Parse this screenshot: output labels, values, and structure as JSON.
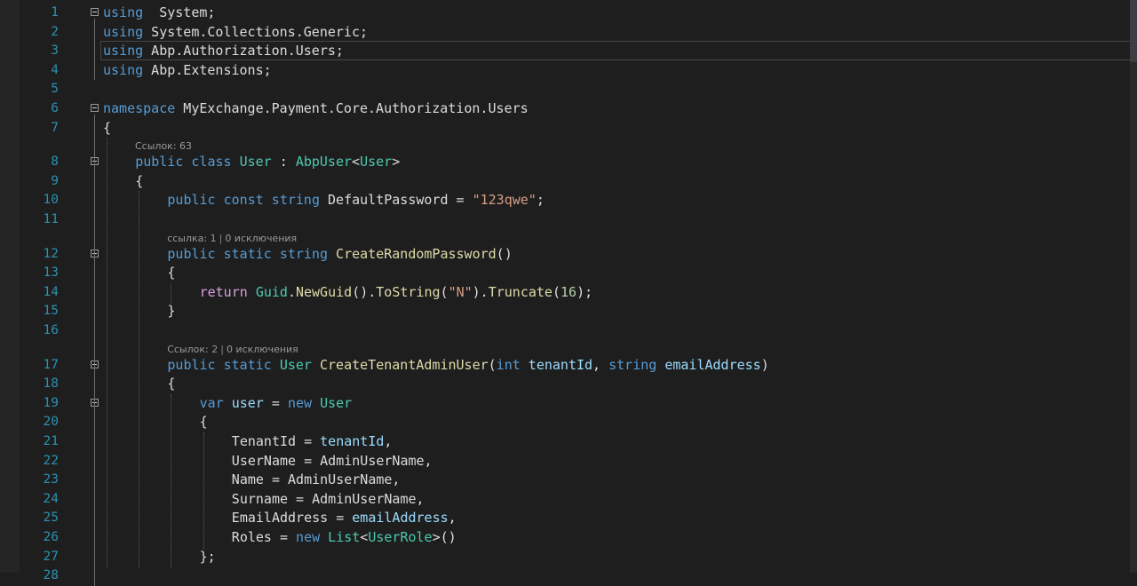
{
  "editor": {
    "language": "C#",
    "lines": [
      {
        "n": "1",
        "fold": true,
        "tokens": [
          [
            "kw",
            "using"
          ],
          [
            "",
            "  System;"
          ]
        ]
      },
      {
        "n": "2",
        "tokens": [
          [
            "kw",
            "using"
          ],
          [
            "",
            " System.Collections.Generic;"
          ]
        ]
      },
      {
        "n": "3",
        "tokens": [
          [
            "kw",
            "using"
          ],
          [
            "",
            " Abp.Authorization.Users;"
          ]
        ]
      },
      {
        "n": "4",
        "tokens": [
          [
            "kw",
            "using"
          ],
          [
            "",
            " Abp.Extensions;"
          ]
        ]
      },
      {
        "n": "5",
        "tokens": []
      },
      {
        "n": "6",
        "fold": true,
        "tokens": [
          [
            "kw",
            "namespace"
          ],
          [
            "",
            " MyExchange.Payment.Core.Authorization.Users"
          ]
        ]
      },
      {
        "n": "7",
        "tokens": [
          [
            "",
            "{"
          ]
        ]
      },
      {
        "lens": {
          "refs": "Ссылок: 63"
        }
      },
      {
        "n": "8",
        "fold": true,
        "indent": 1,
        "tokens": [
          [
            "kw",
            "public"
          ],
          [
            "",
            " "
          ],
          [
            "kw",
            "class"
          ],
          [
            "",
            " "
          ],
          [
            "ty",
            "User"
          ],
          [
            "",
            " : "
          ],
          [
            "ty",
            "AbpUser"
          ],
          [
            "",
            "<"
          ],
          [
            "ty",
            "User"
          ],
          [
            "",
            ">"
          ]
        ]
      },
      {
        "n": "9",
        "indent": 1,
        "tokens": [
          [
            "",
            "{"
          ]
        ]
      },
      {
        "n": "10",
        "indent": 2,
        "tokens": [
          [
            "kw",
            "public"
          ],
          [
            "",
            " "
          ],
          [
            "kw",
            "const"
          ],
          [
            "",
            " "
          ],
          [
            "kw",
            "string"
          ],
          [
            "",
            " DefaultPassword = "
          ],
          [
            "str",
            "\"123qwe\""
          ],
          [
            "",
            ";"
          ]
        ]
      },
      {
        "n": "11",
        "tokens": []
      },
      {
        "lens": {
          "refs": "ссылка: 1",
          "exceptions": "0 исключения"
        },
        "indent": 2
      },
      {
        "n": "12",
        "fold": true,
        "indent": 2,
        "tokens": [
          [
            "kw",
            "public"
          ],
          [
            "",
            " "
          ],
          [
            "kw",
            "static"
          ],
          [
            "",
            " "
          ],
          [
            "kw",
            "string"
          ],
          [
            "",
            " "
          ],
          [
            "fn",
            "CreateRandomPassword"
          ],
          [
            "",
            "()"
          ]
        ]
      },
      {
        "n": "13",
        "indent": 2,
        "tokens": [
          [
            "",
            "{"
          ]
        ]
      },
      {
        "n": "14",
        "indent": 3,
        "tokens": [
          [
            "kw2",
            "return"
          ],
          [
            "",
            " "
          ],
          [
            "ty",
            "Guid"
          ],
          [
            "",
            "."
          ],
          [
            "fn",
            "NewGuid"
          ],
          [
            "",
            "()."
          ],
          [
            "fn",
            "ToString"
          ],
          [
            "",
            "("
          ],
          [
            "str",
            "\"N\""
          ],
          [
            "",
            ")."
          ],
          [
            "fn",
            "Truncate"
          ],
          [
            "",
            "("
          ],
          [
            "num",
            "16"
          ],
          [
            "",
            ");"
          ]
        ]
      },
      {
        "n": "15",
        "indent": 2,
        "tokens": [
          [
            "",
            "}"
          ]
        ]
      },
      {
        "n": "16",
        "tokens": []
      },
      {
        "lens": {
          "refs": "Ссылок: 2",
          "exceptions": "0 исключения"
        },
        "indent": 2
      },
      {
        "n": "17",
        "fold": true,
        "indent": 2,
        "tokens": [
          [
            "kw",
            "public"
          ],
          [
            "",
            " "
          ],
          [
            "kw",
            "static"
          ],
          [
            "",
            " "
          ],
          [
            "ty",
            "User"
          ],
          [
            "",
            " "
          ],
          [
            "fn",
            "CreateTenantAdminUser"
          ],
          [
            "",
            "("
          ],
          [
            "kw",
            "int"
          ],
          [
            "",
            " "
          ],
          [
            "par",
            "tenantId"
          ],
          [
            "",
            ", "
          ],
          [
            "kw",
            "string"
          ],
          [
            "",
            " "
          ],
          [
            "par",
            "emailAddress"
          ],
          [
            "",
            ")"
          ]
        ]
      },
      {
        "n": "18",
        "indent": 2,
        "tokens": [
          [
            "",
            "{"
          ]
        ]
      },
      {
        "n": "19",
        "fold": true,
        "indent": 3,
        "tokens": [
          [
            "kw",
            "var"
          ],
          [
            "",
            " "
          ],
          [
            "par",
            "user"
          ],
          [
            "",
            " = "
          ],
          [
            "kw",
            "new"
          ],
          [
            "",
            " "
          ],
          [
            "ty",
            "User"
          ]
        ]
      },
      {
        "n": "20",
        "indent": 3,
        "tokens": [
          [
            "",
            "{"
          ]
        ]
      },
      {
        "n": "21",
        "indent": 4,
        "tokens": [
          [
            "",
            "TenantId = "
          ],
          [
            "par",
            "tenantId"
          ],
          [
            "",
            ","
          ]
        ]
      },
      {
        "n": "22",
        "indent": 4,
        "tokens": [
          [
            "",
            "UserName = AdminUserName,"
          ]
        ]
      },
      {
        "n": "23",
        "indent": 4,
        "tokens": [
          [
            "",
            "Name = AdminUserName,"
          ]
        ]
      },
      {
        "n": "24",
        "indent": 4,
        "tokens": [
          [
            "",
            "Surname = AdminUserName,"
          ]
        ]
      },
      {
        "n": "25",
        "indent": 4,
        "tokens": [
          [
            "",
            "EmailAddress = "
          ],
          [
            "par",
            "emailAddress"
          ],
          [
            "",
            ","
          ]
        ]
      },
      {
        "n": "26",
        "indent": 4,
        "tokens": [
          [
            "",
            "Roles = "
          ],
          [
            "kw",
            "new"
          ],
          [
            "",
            " "
          ],
          [
            "ty",
            "List"
          ],
          [
            "",
            "<"
          ],
          [
            "ty",
            "UserRole"
          ],
          [
            "",
            ">()"
          ]
        ]
      },
      {
        "n": "27",
        "indent": 3,
        "tokens": [
          [
            "",
            "};"
          ]
        ]
      },
      {
        "n": "28",
        "tokens": []
      }
    ]
  }
}
